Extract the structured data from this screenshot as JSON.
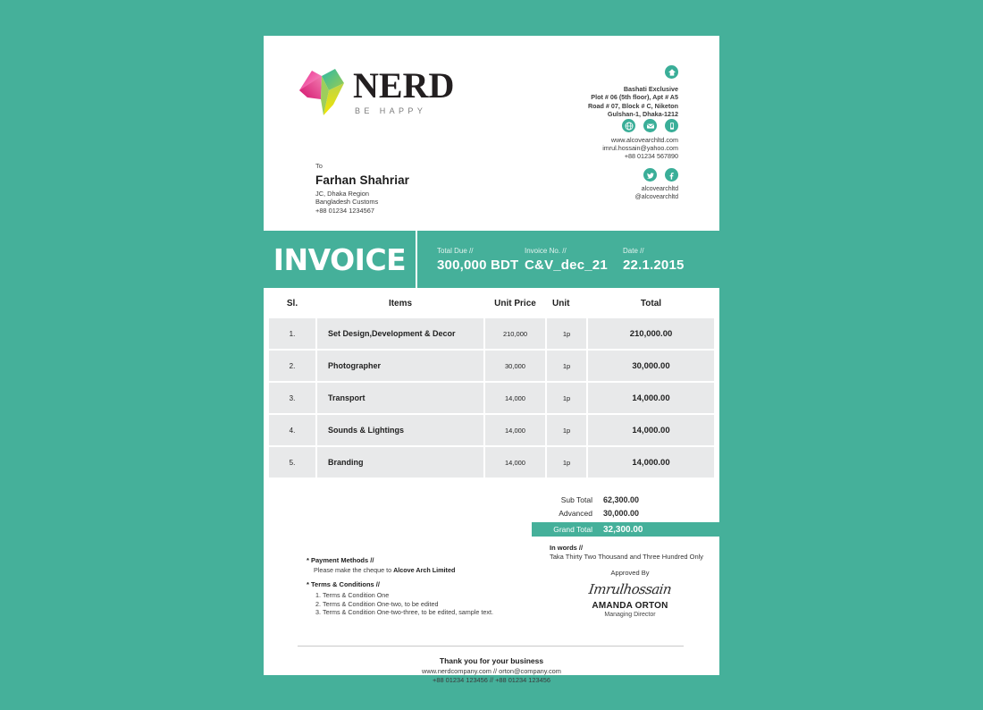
{
  "theme": {
    "teal": "#45b09a",
    "row_grey": "#e8e9ea",
    "sheet": "#ffffff"
  },
  "header": {
    "logo": {
      "name": "NERD",
      "tagline": "BE HAPPY",
      "mark_colors": [
        "#e6197d",
        "#f5a4c7",
        "#8dc63f",
        "#f2e500",
        "#1bb2a8"
      ]
    },
    "company_address": {
      "icon": "home-icon",
      "lines": [
        "Bashati Exclusive",
        "Plot # 06 (5th floor), Apt # A5",
        "Road # 07, Block # C, Niketon",
        "Gulshan-1, Dhaka-1212"
      ]
    },
    "contact": {
      "icons": [
        "globe-icon",
        "envelope-icon",
        "phone-icon"
      ],
      "website": "www.alcovearchltd.com",
      "email": "imrul.hossain@yahoo.com",
      "phone": "+88 01234 567890"
    },
    "social": {
      "icons": [
        "twitter-icon",
        "facebook-icon"
      ],
      "handle1": "alcovearchltd",
      "handle2": "@alcovearchltd"
    },
    "bill_to": {
      "label": "To",
      "name": "Farhan Shahriar",
      "lines": [
        "JC, Dhaka Region",
        "Bangladesh Customs",
        "+88 01234 1234567"
      ]
    }
  },
  "banner": {
    "title": "INVOICE",
    "meta": [
      {
        "key": "Total Due //",
        "value": "300,000 BDT"
      },
      {
        "key": "Invoice No. //",
        "value": "C&V_dec_21"
      },
      {
        "key": "Date //",
        "value": "22.1.2015"
      }
    ]
  },
  "table": {
    "columns": [
      "Sl.",
      "Items",
      "Unit Price",
      "Unit",
      "Total"
    ],
    "rows": [
      {
        "sl": "1.",
        "item": "Set Design,Development & Decor",
        "price": "210,000",
        "unit": "1p",
        "total": "210,000.00"
      },
      {
        "sl": "2.",
        "item": "Photographer",
        "price": "30,000",
        "unit": "1p",
        "total": "30,000.00"
      },
      {
        "sl": "3.",
        "item": "Transport",
        "price": "14,000",
        "unit": "1p",
        "total": "14,000.00"
      },
      {
        "sl": "4.",
        "item": "Sounds & Lightings",
        "price": "14,000",
        "unit": "1p",
        "total": "14,000.00"
      },
      {
        "sl": "5.",
        "item": "Branding",
        "price": "14,000",
        "unit": "1p",
        "total": "14,000.00"
      }
    ]
  },
  "totals": {
    "sub_total_label": "Sub Total",
    "sub_total_value": "62,300.00",
    "advanced_label": "Advanced",
    "advanced_value": "30,000.00",
    "grand_total_label": "Grand Total",
    "grand_total_value": "32,300.00"
  },
  "in_words": {
    "label": "In words //",
    "text": "Taka Thirty Two Thousand and Three Hundred Only"
  },
  "payment": {
    "heading": "* Payment Methods //",
    "line_prefix": "Please make the cheque to ",
    "line_bold": "Alcove Arch Limited"
  },
  "terms": {
    "heading": "* Terms & Conditions //",
    "items": [
      "Terms & Condition One",
      "Terms & Condition One-two, to be edited",
      "Terms & Condition One-two-three, to be edited, sample text."
    ]
  },
  "approval": {
    "label": "Approved By",
    "signature": "Imrulhossain",
    "name": "AMANDA ORTON",
    "title": "Managing Director"
  },
  "footer": {
    "thanks": "Thank you for your business",
    "web_email": "www.nerdcompany.com  // orton@company.com",
    "phones": "+88 01234 123456 // +88 01234 123456"
  }
}
